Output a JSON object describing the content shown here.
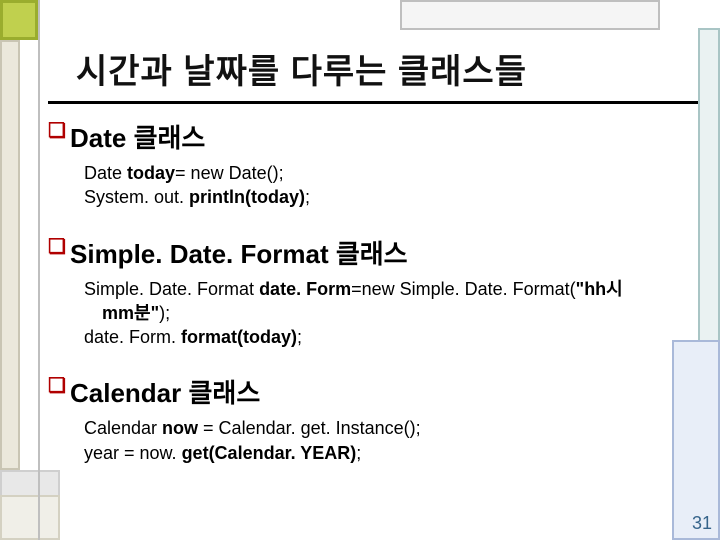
{
  "title": "시간과 날짜를 다루는 클래스들",
  "sections": [
    {
      "bullet": "❏",
      "heading": "Date 클래스",
      "lines": [
        [
          {
            "t": "Date ",
            "b": false
          },
          {
            "t": "today",
            "b": true
          },
          {
            "t": "= new Date();",
            "b": false
          }
        ],
        [
          {
            "t": "System. out. ",
            "b": false
          },
          {
            "t": "println(today)",
            "b": true
          },
          {
            "t": ";",
            "b": false
          }
        ]
      ]
    },
    {
      "bullet": "❏",
      "heading": "Simple. Date. Format 클래스",
      "lines": [
        [
          {
            "t": "Simple. Date. Format ",
            "b": false
          },
          {
            "t": "date. Form",
            "b": true
          },
          {
            "t": "=new Simple. Date. Format(",
            "b": false
          },
          {
            "t": "\"hh시",
            "b": true
          }
        ],
        [
          {
            "t": "mm분\"",
            "b": true
          },
          {
            "t": ");",
            "b": false
          }
        ],
        [
          {
            "t": "date. Form. ",
            "b": false
          },
          {
            "t": "format(today)",
            "b": true
          },
          {
            "t": ";",
            "b": false
          }
        ]
      ]
    },
    {
      "bullet": "❏",
      "heading": "Calendar 클래스",
      "lines": [
        [
          {
            "t": "Calendar ",
            "b": false
          },
          {
            "t": "now ",
            "b": true
          },
          {
            "t": "= Calendar. get. Instance();",
            "b": false
          }
        ],
        [
          {
            "t": "year = now. ",
            "b": false
          },
          {
            "t": "get(Calendar. YEAR)",
            "b": true
          },
          {
            "t": ";",
            "b": false
          }
        ]
      ]
    }
  ],
  "pagenum": "31"
}
